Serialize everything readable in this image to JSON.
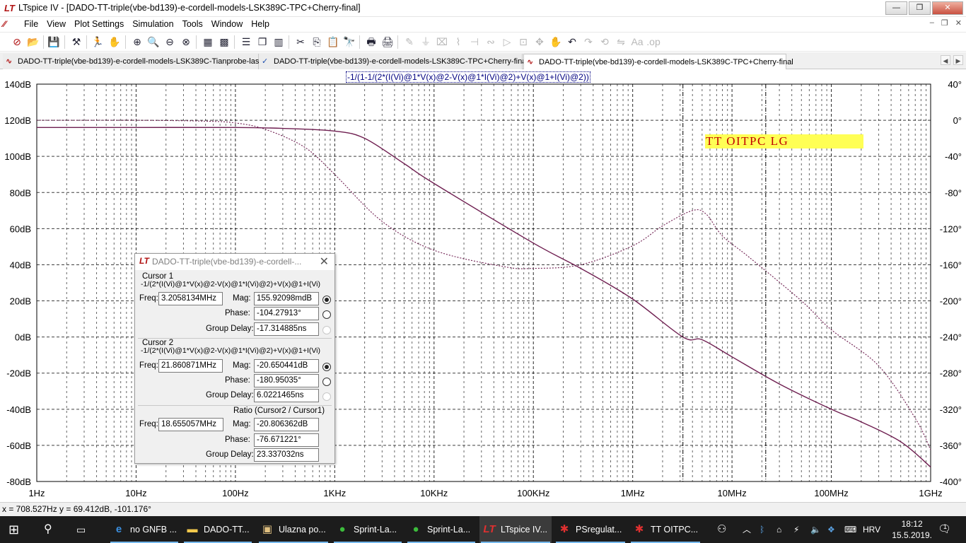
{
  "window": {
    "title": "LTspice IV - [DADO-TT-triple(vbe-bd139)-e-cordell-models-LSK389C-TPC+Cherry-final]",
    "buttons": {
      "minimize": "—",
      "restore": "❐",
      "close": "✕"
    }
  },
  "menu": {
    "items": [
      "File",
      "View",
      "Plot Settings",
      "Simulation",
      "Tools",
      "Window",
      "Help"
    ],
    "mdi": {
      "minimize": "–",
      "restore": "❐",
      "close": "✕"
    }
  },
  "tabs": [
    {
      "label": "DADO-TT-triple(vbe-bd139)-e-cordell-models-LSK389C-Tianprobe-last",
      "icon": "waveform-icon"
    },
    {
      "label": "DADO-TT-triple(vbe-bd139)-e-cordell-models-LSK389C-TPC+Cherry-final",
      "icon": "schematic-icon"
    },
    {
      "label": "DADO-TT-triple(vbe-bd139)-e-cordell-models-LSK389C-TPC+Cherry-final",
      "icon": "waveform-icon",
      "active": true
    }
  ],
  "plot": {
    "expression": "-1/(1-1/(2*(I(Vi)@1*V(x)@2-V(x)@1*I(Vi)@2)+V(x)@1+I(Vi)@2))",
    "annotation": "TT  OITPC  LG",
    "colors": {
      "trace": "#6e1e50",
      "grid": "#000000"
    }
  },
  "chart_data": {
    "type": "line",
    "title": "-1/(1-1/(2*(I(Vi)@1*V(x)@2-V(x)@1*I(Vi)@2)+V(x)@1+I(Vi)@2))",
    "xscale": "log",
    "xlim": [
      1,
      1000000000
    ],
    "ylim": [
      -80,
      140
    ],
    "y2lim": [
      -400,
      40
    ],
    "x_tick_labels": [
      "1Hz",
      "10Hz",
      "100Hz",
      "1KHz",
      "10KHz",
      "100KHz",
      "1MHz",
      "10MHz",
      "100MHz",
      "1GHz"
    ],
    "y_tick_labels": [
      "140dB",
      "120dB",
      "100dB",
      "80dB",
      "60dB",
      "40dB",
      "20dB",
      "0dB",
      "-20dB",
      "-40dB",
      "-60dB",
      "-80dB"
    ],
    "y2_tick_labels": [
      "40°",
      "0°",
      "-40°",
      "-80°",
      "-120°",
      "-160°",
      "-200°",
      "-240°",
      "-280°",
      "-320°",
      "-360°",
      "-400°"
    ],
    "series": [
      {
        "style": "solid",
        "axis": "left",
        "x": [
          1,
          10,
          100,
          300,
          1000,
          2000,
          5000,
          10000,
          100000,
          300000,
          1000000,
          3200000,
          5000000,
          10000000,
          30000000,
          100000000,
          200000000,
          500000000,
          1000000000
        ],
        "y": [
          116,
          116,
          116,
          115.5,
          114,
          110,
          96,
          85,
          52,
          38,
          21,
          0,
          -1.5,
          -11,
          -26,
          -40,
          -47,
          -58,
          -72
        ]
      },
      {
        "style": "dashed",
        "axis": "right",
        "x": [
          1,
          10,
          50,
          100,
          200,
          500,
          1000,
          3000,
          10000,
          50000,
          100000,
          300000,
          1000000,
          2000000,
          4000000,
          5500000,
          8000000,
          15000000,
          50000000,
          100000000,
          300000000,
          700000000,
          1000000000
        ],
        "y": [
          0,
          0,
          -1,
          -3,
          -10,
          -30,
          -60,
          -112,
          -144,
          -162,
          -164,
          -160,
          -139,
          -117,
          -100,
          -104,
          -128,
          -152,
          -200,
          -232,
          -272,
          -330,
          -365
        ]
      }
    ]
  },
  "cursor_dialog": {
    "title": "DADO-TT-triple(vbe-bd139)-e-cordell-...",
    "cursor1": {
      "heading": "Cursor 1",
      "expression": "-1/(2*(I(Vi)@1*V(x)@2-V(x)@1*I(Vi)@2)+V(x)@1+I(Vi)",
      "freq_label": "Freq:",
      "freq": "3.2058134MHz",
      "mag_label": "Mag:",
      "mag": "155.92098mdB",
      "phase_label": "Phase:",
      "phase": "-104.27913°",
      "gd_label": "Group Delay:",
      "group_delay": "-17.314885ns"
    },
    "cursor2": {
      "heading": "Cursor 2",
      "expression": "-1/(2*(I(Vi)@1*V(x)@2-V(x)@1*I(Vi)@2)+V(x)@1+I(Vi)",
      "freq_label": "Freq:",
      "freq": "21.860871MHz",
      "mag_label": "Mag:",
      "mag": "-20.650441dB",
      "phase_label": "Phase:",
      "phase": "-180.95035°",
      "gd_label": "Group Delay:",
      "group_delay": "6.0221465ns"
    },
    "ratio": {
      "heading": "Ratio (Cursor2 / Cursor1)",
      "freq_label": "Freq:",
      "freq": "18.655057MHz",
      "mag_label": "Mag:",
      "mag": "-20.806362dB",
      "phase_label": "Phase:",
      "phase": "-76.671221°",
      "gd_label": "Group Delay:",
      "group_delay": "23.337032ns"
    }
  },
  "status": {
    "text": "x = 708.527Hz     y = 69.412dB, -101.176°"
  },
  "taskbar": {
    "items": [
      {
        "label": "no GNFB ...",
        "icon": "edge-icon"
      },
      {
        "label": "DADO-TT...",
        "icon": "folder-icon"
      },
      {
        "label": "Ulazna po...",
        "icon": "image-icon"
      },
      {
        "label": "Sprint-La...",
        "icon": "sprint-icon"
      },
      {
        "label": "Sprint-La...",
        "icon": "sprint-icon"
      },
      {
        "label": "LTspice IV...",
        "icon": "ltspice-icon"
      },
      {
        "label": "PSregulat...",
        "icon": "ltspice-red-icon"
      },
      {
        "label": "TT OITPC...",
        "icon": "ltspice-red-icon"
      }
    ],
    "language": "HRV",
    "time": "18:12",
    "date": "15.5.2019.",
    "notification_count": "1"
  }
}
